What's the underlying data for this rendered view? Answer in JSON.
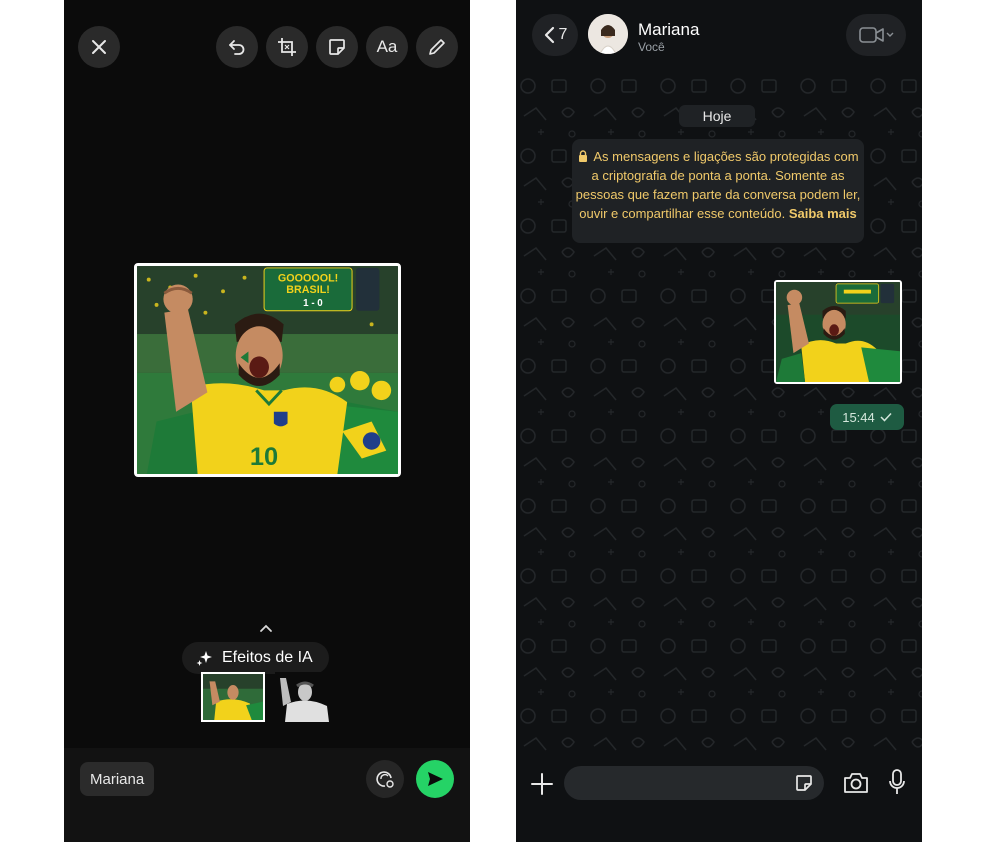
{
  "editor": {
    "ai_effects_label": "Efeitos de IA",
    "recipient": "Mariana",
    "text_tool_label": "Aa",
    "photo": {
      "banner_line1": "GOOOOOL!",
      "banner_line2": "BRASIL!",
      "score": "1 - 0",
      "jersey_number": "10"
    },
    "icons": [
      "close-icon",
      "undo-icon",
      "crop-icon",
      "sticker-icon",
      "pencil-icon",
      "sparkles-icon",
      "chevron-up-icon",
      "hd-icon",
      "send-icon"
    ]
  },
  "chat": {
    "back_count": "7",
    "contact_name": "Mariana",
    "contact_status": "Você",
    "date_chip": "Hoje",
    "encryption_notice": "As mensagens e ligações são protegidas com a criptografia de ponta a ponta. Somente as pessoas que fazem parte da conversa podem ler, ouvir e compartilhar esse conteúdo.",
    "learn_more": "Saiba mais",
    "message_time": "15:44",
    "icons": [
      "chevron-left-icon",
      "video-call-icon",
      "lock-icon",
      "check-icon",
      "plus-icon",
      "sticker-icon",
      "camera-icon",
      "mic-icon"
    ]
  },
  "colors": {
    "send_green": "#25d366",
    "bubble_green": "#1e5b42",
    "notice_text": "#f0c96a",
    "jersey_yellow": "#f2d21b"
  }
}
